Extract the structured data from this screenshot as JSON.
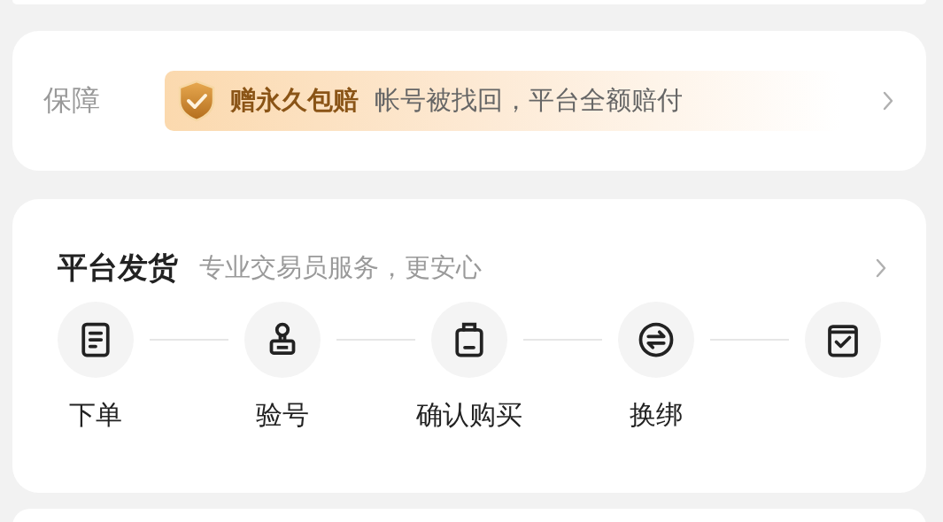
{
  "guarantee": {
    "label": "保障",
    "highlight": "赠永久包赔",
    "text": "帐号被找回，平台全额赔付"
  },
  "delivery": {
    "title": "平台发货",
    "subtitle": "专业交易员服务，更安心",
    "steps": [
      {
        "kind": "document",
        "label": "下单"
      },
      {
        "kind": "stamp",
        "label": "验号"
      },
      {
        "kind": "bag",
        "label": "确认购买"
      },
      {
        "kind": "exchange",
        "label": "换绑"
      },
      {
        "kind": "checklist"
      }
    ]
  }
}
